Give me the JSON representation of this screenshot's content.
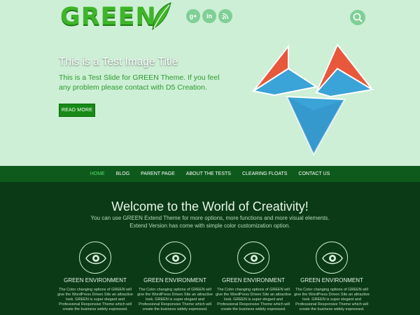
{
  "header": {
    "logo_text": "GREEN",
    "social": [
      "google-plus-icon",
      "linkedin-icon",
      "rss-icon"
    ]
  },
  "slide": {
    "title": "This is a Test Image Title",
    "text": "This is a Test Slide for GREEN Theme. If you feel any problem please contact with D5 Creation.",
    "button": "READ MORE"
  },
  "nav": {
    "items": [
      "HOME",
      "BLOG",
      "PARENT PAGE",
      "ABOUT THE TESTS",
      "CLEARING FLOATS",
      "CONTACT US"
    ],
    "active_index": 0
  },
  "welcome": {
    "title": "Welcome to the World of Creativity!",
    "text": "You can use GREEN Extend Theme for more options, more functions and more visual elements. Extend Version has come with simple color customization option."
  },
  "features": [
    {
      "title": "GREEN ENVIRONMENT",
      "icon": "eye-icon",
      "text": "The Color changing options of GREEN will give the WordPress Driven Site an attractive look. GREEN is super elegant and Professional Responsive Theme which will create the business widely expressed."
    },
    {
      "title": "GREEN ENVIRONMENT",
      "icon": "eye-icon",
      "text": "The Color changing options of GREEN will give the WordPress Driven Site an attractive look. GREEN is super elegant and Professional Responsive Theme which will create the business widely expressed."
    },
    {
      "title": "GREEN ENVIRONMENT",
      "icon": "eye-icon",
      "text": "The Color changing options of GREEN will give the WordPress Driven Site an attractive look. GREEN is super elegant and Professional Responsive Theme which will create the business widely expressed."
    },
    {
      "title": "GREEN ENVIRONMENT",
      "icon": "eye-icon",
      "text": "The Color changing options of GREEN will give the WordPress Driven Site an attractive look. GREEN is super elegant and Professional Responsive Theme which will create the business widely expressed."
    }
  ],
  "colors": {
    "hero_bg": "#cdefd6",
    "nav_bg": "#0d5a1c",
    "main_bg": "#0b3b16",
    "accent": "#3fb52a",
    "nav_active": "#56e06a"
  }
}
